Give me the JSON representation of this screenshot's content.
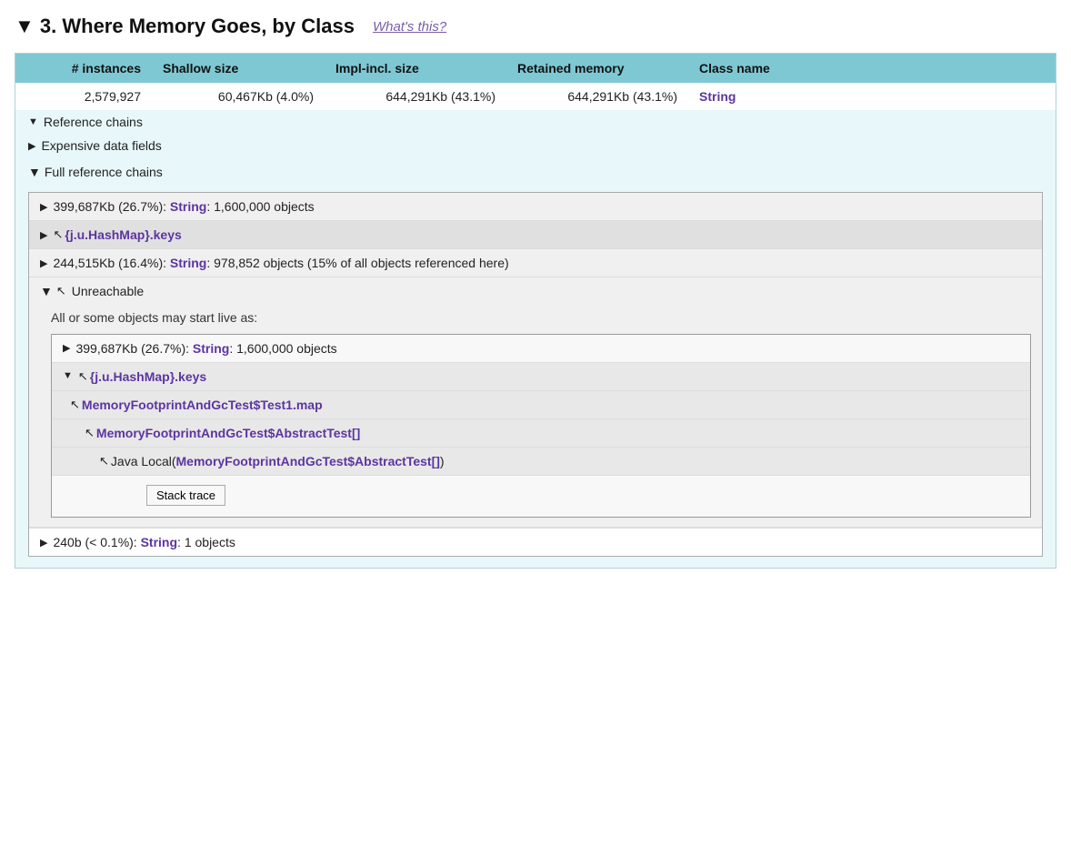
{
  "section": {
    "title": "3. Where Memory Goes, by Class",
    "collapse_arrow": "▼",
    "whats_this": "What's this?"
  },
  "table": {
    "headers": [
      "# instances",
      "Shallow size",
      "Impl-incl. size",
      "Retained memory",
      "Class name"
    ],
    "row": {
      "instances": "2,579,927",
      "shallow_size": "60,467Kb (4.0%)",
      "impl_size": "644,291Kb (43.1%)",
      "retained": "644,291Kb (43.1%)",
      "classname": "String"
    }
  },
  "expandable_sections": {
    "reference_chains_label": "Reference chains",
    "expensive_data_label": "Expensive data fields",
    "full_ref_chains_label": "Full reference chains"
  },
  "chains": [
    {
      "id": "chain1",
      "arrow": "▶",
      "text_plain": "399,687Kb (26.7%): ",
      "text_link": "String",
      "text_rest": ": 1,600,000 objects"
    },
    {
      "id": "chain2",
      "arrow": "▶",
      "highlighted": true,
      "backslash": true,
      "text_link": "{j.u.HashMap}.keys",
      "text_plain": ""
    },
    {
      "id": "chain3",
      "arrow": "▶",
      "text_plain": "244,515Kb (16.4%): ",
      "text_link": "String",
      "text_rest": ": 978,852 objects (15% of all objects referenced here)"
    }
  ],
  "unreachable": {
    "arrow_down": "▼",
    "backslash": true,
    "label": "Unreachable",
    "description": "All or some objects may start live as:",
    "inner_chains": [
      {
        "id": "inner1",
        "arrow": "▶",
        "text_plain": "399,687Kb (26.7%): ",
        "text_link": "String",
        "text_rest": ": 1,600,000 objects"
      },
      {
        "id": "inner2",
        "arrow": "▼",
        "highlighted": true,
        "indent": 0,
        "backslash": true,
        "text_link": "{j.u.HashMap}.keys"
      },
      {
        "id": "inner3",
        "indent": 1,
        "backslash": true,
        "text_link": "MemoryFootprintAndGcTest$Test1.map"
      },
      {
        "id": "inner4",
        "indent": 2,
        "backslash": true,
        "text_link": "MemoryFootprintAndGcTest$AbstractTest[]"
      },
      {
        "id": "inner5",
        "indent": 3,
        "backslash": true,
        "text_plain": "Java Local(",
        "text_link": "MemoryFootprintAndGcTest$AbstractTest[]",
        "text_rest": ")"
      }
    ],
    "stack_trace_label": "Stack trace"
  },
  "last_chain": {
    "arrow": "▶",
    "text_plain": "240b (< 0.1%): ",
    "text_link": "String",
    "text_rest": ": 1 objects"
  }
}
